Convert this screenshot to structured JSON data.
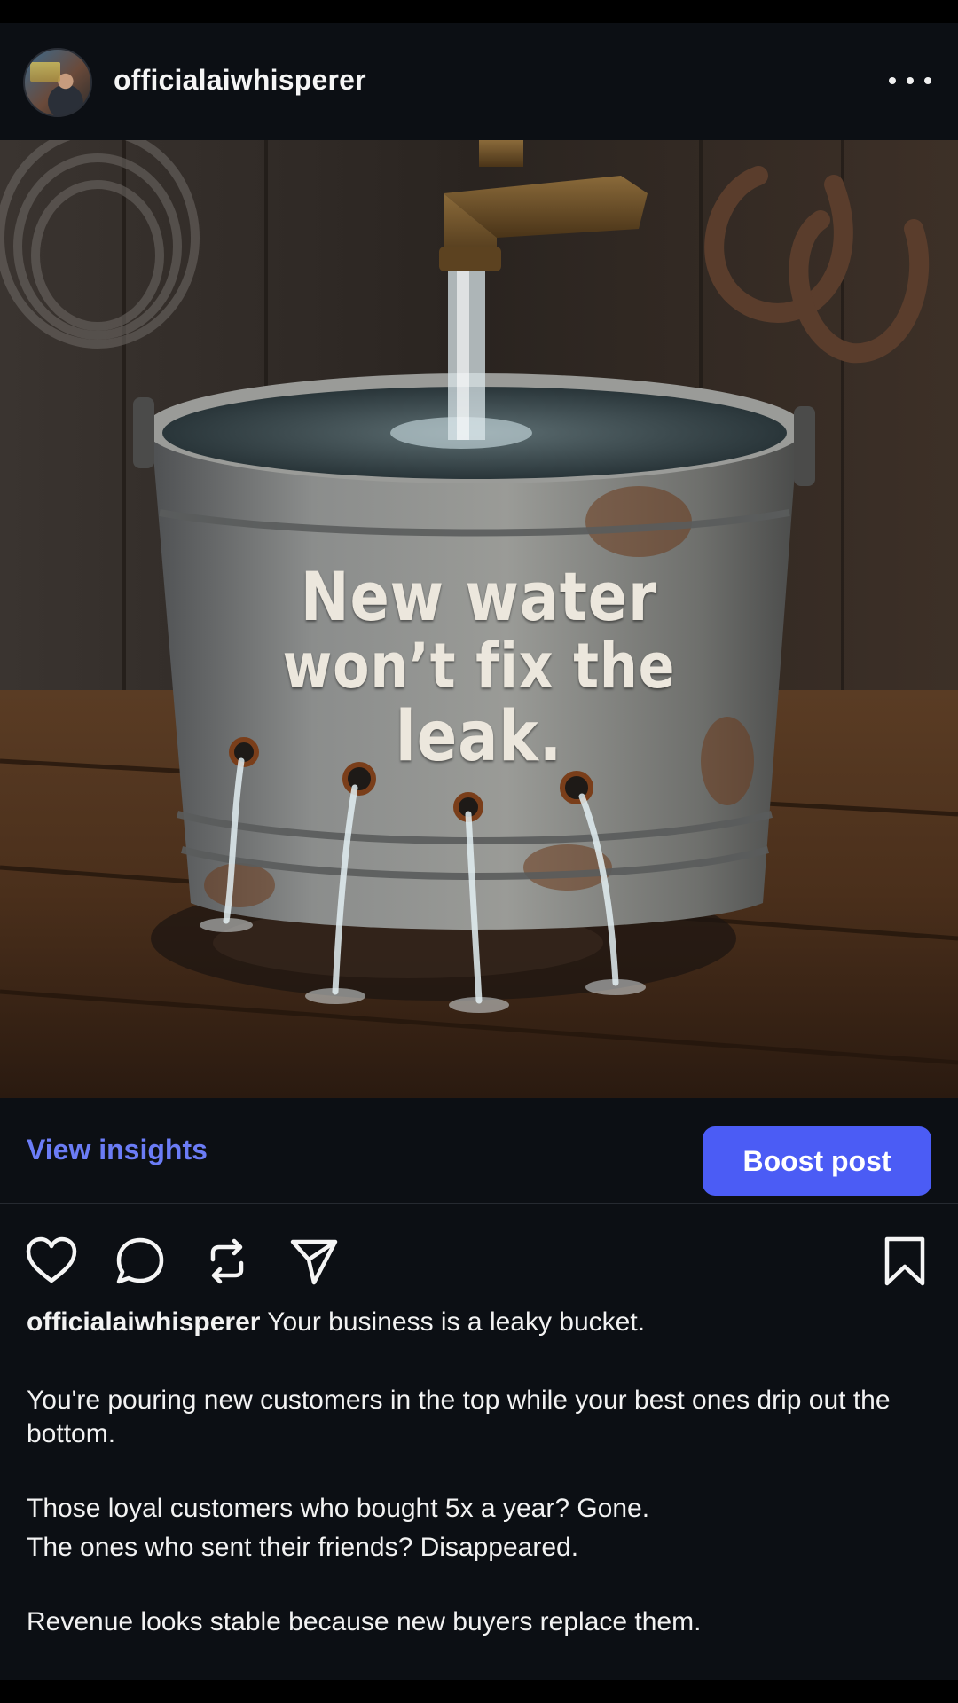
{
  "post": {
    "username": "officialaiwhisperer",
    "avatar_icon": "profile-avatar",
    "more_icon": "more-horizontal-icon"
  },
  "image": {
    "text_line1": "New water",
    "text_line2": "won’t fix the",
    "text_line3": "leak."
  },
  "insights_bar": {
    "view_insights_label": "View insights",
    "boost_label": "Boost post",
    "accent_color": "#4b5cf5",
    "link_color": "#6b7cf6"
  },
  "actions": {
    "icons": [
      "heart-icon",
      "comment-icon",
      "repost-icon",
      "share-icon",
      "bookmark-icon"
    ]
  },
  "caption": {
    "username": "officialaiwhisperer",
    "line1": "Your business is a leaky bucket.",
    "para2": "You're pouring new customers in the top while your best ones drip out the bottom.",
    "line3": "Those loyal customers who bought 5x a year? Gone.",
    "line4": "The ones who sent their friends? Disappeared.",
    "line5": "Revenue looks stable because new buyers replace them."
  }
}
